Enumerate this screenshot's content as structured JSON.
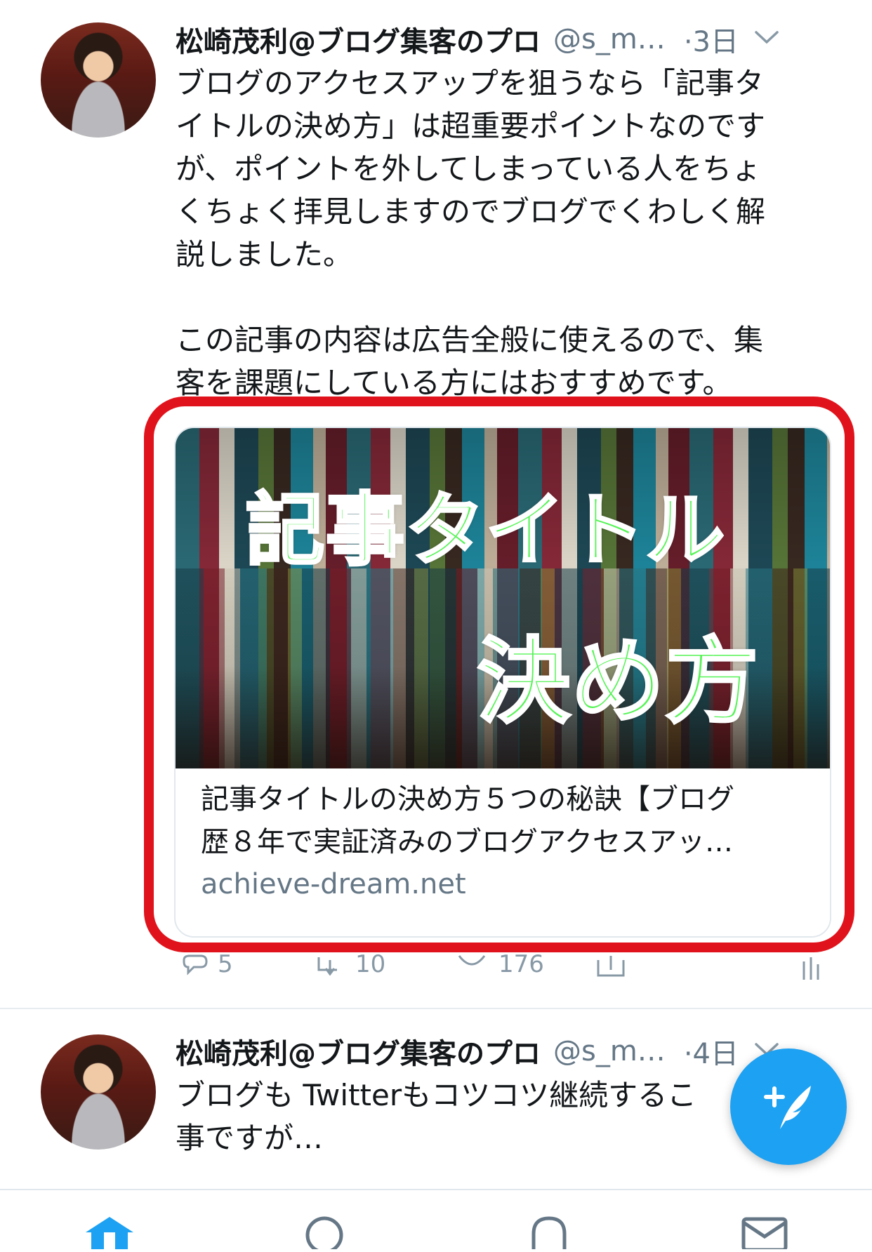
{
  "tweets": [
    {
      "name": "松崎茂利@ブログ集客のプロ",
      "handle": "@s_m…",
      "time": "·3日",
      "text": "ブログのアクセスアップを狙うなら「記事タ\nイトルの決め方」は超重要ポイントなのです\nが、ポイントを外してしまっている人をちょ\nくちょく拝見しますのでブログでくわしく解\n説しました。\n\nこの記事の内容は広告全般に使えるので、集\n客を課題にしている方にはおすすめです。",
      "card": {
        "overlay_line1": "記事タイトル",
        "overlay_line2": "決め方",
        "title": "記事タイトルの決め方５つの秘訣【ブログ\n歴８年で実証済みのブログアクセスアッ…",
        "domain": "achieve-dream.net"
      },
      "actions": {
        "reply_count": "5",
        "retweet_count": "10",
        "like_count": "176"
      }
    },
    {
      "name": "松崎茂利@ブログ集客のプロ",
      "handle": "@s_m…",
      "time": "·4日",
      "text": "ブログも Twitterもコツコツ継続するこ\n事ですが…"
    }
  ],
  "colors": {
    "accent": "#1da1f2",
    "highlight_border": "#e0131c",
    "overlay_text": "#55f455"
  },
  "icons": {
    "tweet1_menu": "chevron-down-icon",
    "tweet2_menu": "chevron-down-icon",
    "fab": "compose-tweet-icon",
    "tabs": [
      "home-icon",
      "search-icon",
      "notifications-icon",
      "messages-icon"
    ]
  }
}
